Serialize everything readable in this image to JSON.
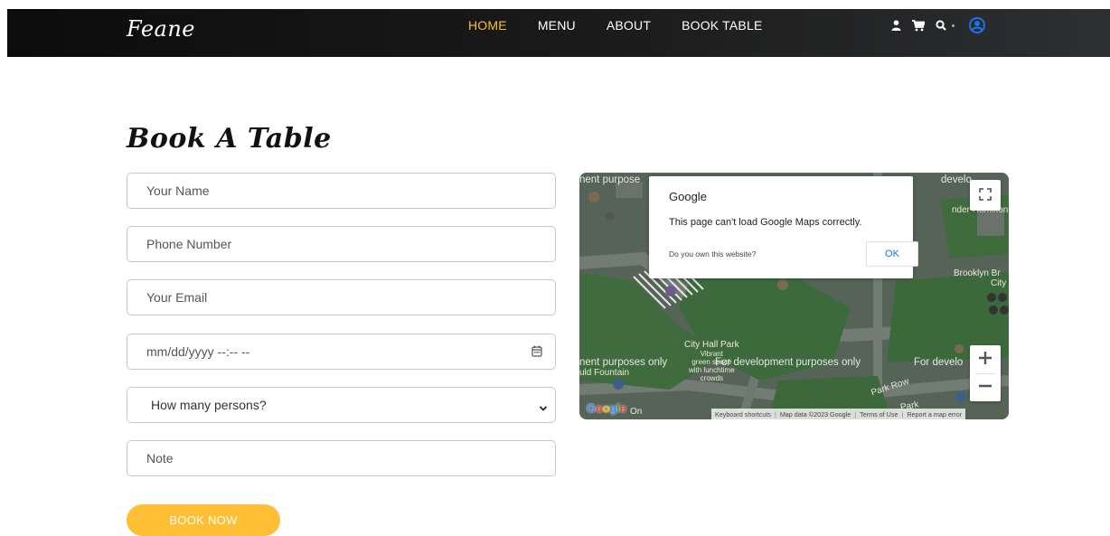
{
  "brand": {
    "name": "Feane"
  },
  "nav": {
    "items": [
      {
        "label": "HOME",
        "active": true
      },
      {
        "label": "MENU",
        "active": false
      },
      {
        "label": "ABOUT",
        "active": false
      },
      {
        "label": "BOOK TABLE",
        "active": false
      }
    ]
  },
  "user_options": {
    "icons": [
      "user-icon",
      "cart-icon",
      "search-icon",
      "account-circle-icon"
    ]
  },
  "book": {
    "title": "Book A Table",
    "fields": {
      "name_placeholder": "Your Name",
      "phone_placeholder": "Phone Number",
      "email_placeholder": "Your Email",
      "datetime_placeholder": "mm/dd/yyyy --:-- --",
      "persons_selected": "How many persons?",
      "note_placeholder": "Note"
    },
    "submit_label": "BOOK NOW"
  },
  "map": {
    "dialog": {
      "brand": "Google",
      "message": "This page can't load Google Maps correctly.",
      "question": "Do you own this website?",
      "ok_label": "OK"
    },
    "watermarks": {
      "top_left": "nent purpose",
      "top_right": "develo",
      "mid_left": "nent purposes only",
      "mid_center": "For development purposes only",
      "mid_right": "For develo"
    },
    "places": {
      "hamilton": "nder Hamilton",
      "brooklyn": "Brooklyn Br",
      "city": "City",
      "city_hall_park": "City Hall Park",
      "vibrant_green": "Vibrant",
      "green_space": "green space",
      "with_lunchtime": "with lunchtime",
      "crowds": "crowds",
      "fountain": "uld Fountain",
      "park_row": "Park Row",
      "park_row_2": "Park"
    },
    "footer": {
      "shortcuts": "Keyboard shortcuts",
      "data": "Map data ©2023 Google",
      "terms": "Terms of Use",
      "report": "Report a map error"
    },
    "logo_text": "Google",
    "logo_suffix": "On"
  },
  "colors": {
    "accent": "#ffbe33",
    "header_bg": "#111111",
    "account_blue": "#1a73e8"
  }
}
